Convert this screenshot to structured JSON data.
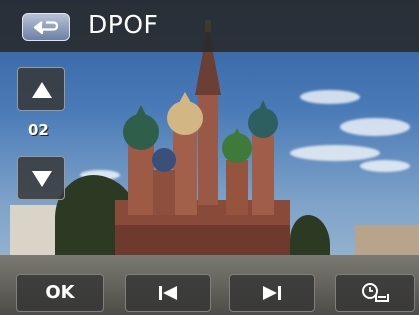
{
  "header": {
    "title": "DPOF"
  },
  "side": {
    "count": "02"
  },
  "bottom": {
    "ok_label": "OK"
  },
  "colors": {
    "bar": "#282828",
    "accent": "#6e7fa3"
  },
  "icons": {
    "back": "back-arrow-icon",
    "up": "triangle-up-icon",
    "down": "triangle-down-icon",
    "prev": "skip-previous-icon",
    "next": "skip-next-icon",
    "date": "clock-date-icon"
  }
}
